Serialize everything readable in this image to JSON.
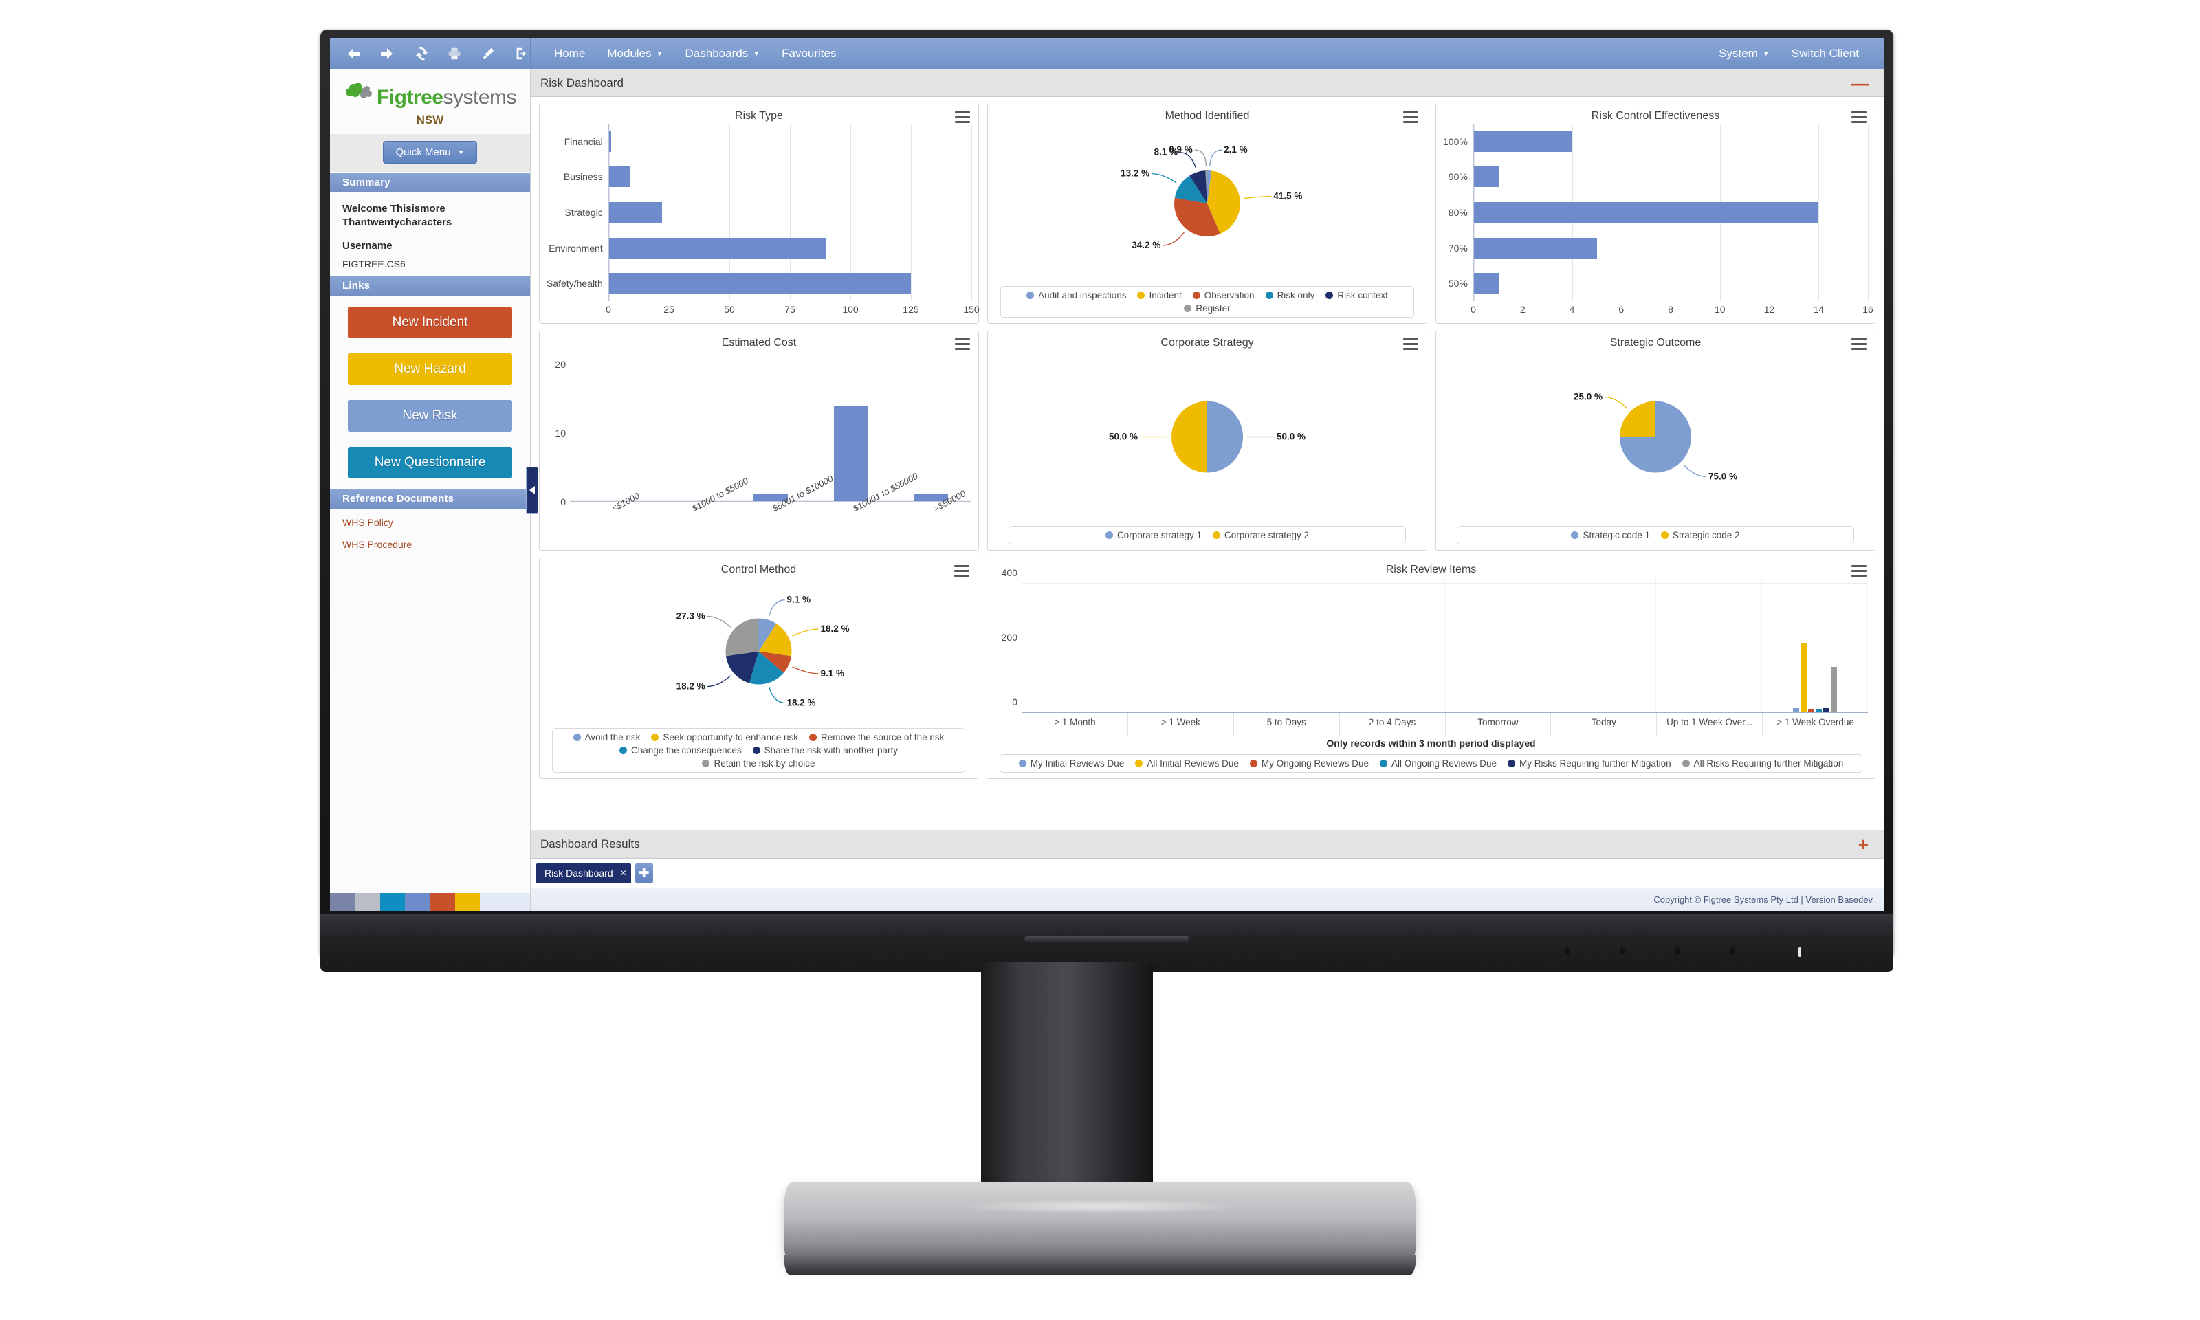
{
  "toolbar": {
    "icons": [
      {
        "name": "back-icon",
        "label": "Back"
      },
      {
        "name": "forward-icon",
        "label": "Forward"
      },
      {
        "name": "refresh-icon",
        "label": "Refresh"
      },
      {
        "name": "print-icon",
        "label": "Print"
      },
      {
        "name": "theme-brush-icon",
        "label": "Theme"
      },
      {
        "name": "logout-icon",
        "label": "Log out"
      }
    ]
  },
  "menu": {
    "items": [
      {
        "label": "Home",
        "caret": false
      },
      {
        "label": "Modules",
        "caret": true
      },
      {
        "label": "Dashboards",
        "caret": true
      },
      {
        "label": "Favourites",
        "caret": false
      }
    ],
    "right": [
      {
        "label": "System",
        "caret": true
      },
      {
        "label": "Switch Client",
        "caret": false
      }
    ],
    "caret_glyph": "▼"
  },
  "sidebar": {
    "logo_primary": "Figtree",
    "logo_secondary": "systems",
    "region": "NSW",
    "quick_menu": "Quick Menu",
    "quick_menu_caret": "▼",
    "summary_header": "Summary",
    "welcome": "Welcome Thisismore Thantwentycharacters",
    "username_label": "Username",
    "username_value": "FIGTREE.CS6",
    "links_header": "Links",
    "links": [
      {
        "label": "New Incident",
        "color": "#c8502b",
        "cls": "link-incident"
      },
      {
        "label": "New Hazard",
        "color": "#efbb00",
        "cls": "link-hazard"
      },
      {
        "label": "New Risk",
        "color": "#7e9dd0",
        "cls": "link-risk"
      },
      {
        "label": "New Questionnaire",
        "color": "#1789b5",
        "cls": "link-quest"
      }
    ],
    "refdocs_header": "Reference Documents",
    "refdocs": [
      {
        "label": "WHS Policy"
      },
      {
        "label": "WHS Procedure"
      }
    ],
    "color_strip": [
      "#7a83a8",
      "#b9bec6",
      "#0f8ec1",
      "#6e8ccb",
      "#c8502b",
      "#efbb00",
      "#e3eaf6"
    ]
  },
  "page": {
    "title": "Risk Dashboard",
    "collapse_glyph": "—",
    "results_title": "Dashboard Results",
    "results_plus_glyph": "+"
  },
  "tabs": {
    "active": "Risk Dashboard",
    "close_glyph": "✕",
    "add_glyph": "✚"
  },
  "footer": {
    "copyright": "Copyright © Figtree Systems Pty Ltd | Version Basedev"
  },
  "colors": {
    "bar_blue": "#6e8ccb",
    "pie_lightblue": "#7e9dd0",
    "pie_yellow": "#efbb00",
    "pie_red": "#c8502b",
    "pie_cyan": "#1789b5",
    "pie_navy": "#1f2f6b",
    "pie_grey": "#9a9a9a",
    "accent_blue": "#7d9ccf",
    "header_grey": "#e3e3e3"
  },
  "chart_data": [
    {
      "id": "risk-type",
      "type": "bar",
      "orientation": "horizontal",
      "title": "Risk Type",
      "categories": [
        "Financial",
        "Business",
        "Strategic",
        "Environment",
        "Safety/health"
      ],
      "values": [
        1,
        9,
        22,
        90,
        125
      ],
      "xticks": [
        0,
        25,
        50,
        75,
        100,
        125,
        150
      ],
      "xlim": [
        0,
        150
      ],
      "ylabel": "",
      "xlabel": "",
      "grid": true,
      "series_color": "#6e8ccb"
    },
    {
      "id": "method-identified",
      "type": "pie",
      "title": "Method Identified",
      "labels": [
        "Audit and inspections",
        "Incident",
        "Observation",
        "Risk only",
        "Risk context",
        "Register"
      ],
      "values": [
        2.1,
        41.5,
        34.2,
        13.2,
        8.1,
        0.9
      ],
      "value_labels": [
        "2.1 %",
        "41.5 %",
        "34.2 %",
        "13.2 %",
        "8.1 %",
        "0.9 %"
      ],
      "colors": [
        "#7e9dd0",
        "#efbb00",
        "#c8502b",
        "#1789b5",
        "#1f2f6b",
        "#9a9a9a"
      ],
      "legend_position": "bottom"
    },
    {
      "id": "risk-control-effectiveness",
      "type": "bar",
      "orientation": "horizontal",
      "title": "Risk Control Effectiveness",
      "categories": [
        "100%",
        "90%",
        "80%",
        "70%",
        "50%"
      ],
      "values": [
        4,
        1,
        14,
        5,
        1
      ],
      "xticks": [
        0,
        2,
        4,
        6,
        8,
        10,
        12,
        14,
        16
      ],
      "xlim": [
        0,
        16
      ],
      "grid": true,
      "series_color": "#6e8ccb"
    },
    {
      "id": "estimated-cost",
      "type": "bar",
      "orientation": "vertical",
      "title": "Estimated Cost",
      "categories": [
        "<$1000",
        "$1000 to $5000",
        "$5001 to $10000",
        "$10001 to $50000",
        ">$50000"
      ],
      "values": [
        0,
        0,
        1,
        14,
        1
      ],
      "yticks": [
        0,
        10,
        20
      ],
      "ylim": [
        0,
        22
      ],
      "grid": true,
      "series_color": "#6e8ccb"
    },
    {
      "id": "corporate-strategy",
      "type": "pie",
      "title": "Corporate Strategy",
      "labels": [
        "Corporate strategy 1",
        "Corporate strategy 2"
      ],
      "values": [
        50.0,
        50.0
      ],
      "value_labels": [
        "50.0 %",
        "50.0 %"
      ],
      "colors": [
        "#7e9dd0",
        "#efbb00"
      ],
      "legend_position": "bottom"
    },
    {
      "id": "strategic-outcome",
      "type": "pie",
      "title": "Strategic Outcome",
      "labels": [
        "Strategic code 1",
        "Strategic code 2"
      ],
      "values": [
        75.0,
        25.0
      ],
      "value_labels": [
        "75.0 %",
        "25.0 %"
      ],
      "colors": [
        "#7e9dd0",
        "#efbb00"
      ],
      "legend_position": "bottom"
    },
    {
      "id": "control-method",
      "type": "pie",
      "title": "Control Method",
      "labels": [
        "Avoid the risk",
        "Seek opportunity to enhance risk",
        "Remove the source of the risk",
        "Change the consequences",
        "Share the risk with another party",
        "Retain the risk by choice"
      ],
      "values": [
        9.1,
        18.2,
        9.1,
        18.2,
        18.2,
        27.3
      ],
      "value_labels": [
        "9.1 %",
        "18.2 %",
        "9.1 %",
        "18.2 %",
        "18.2 %",
        "27.3 %"
      ],
      "colors": [
        "#7e9dd0",
        "#efbb00",
        "#c8502b",
        "#1789b5",
        "#1f2f6b",
        "#9a9a9a"
      ],
      "legend_position": "bottom"
    },
    {
      "id": "risk-review-items",
      "type": "bar",
      "orientation": "vertical",
      "grouped": true,
      "title": "Risk Review Items",
      "categories": [
        "> 1 Month",
        "> 1 Week",
        "5 to Days",
        "2 to 4 Days",
        "Tomorrow",
        "Today",
        "Up to 1 Week Over...",
        "> 1 Week Overdue"
      ],
      "yticks": [
        0,
        200,
        400
      ],
      "ylim": [
        0,
        420
      ],
      "note": "Only records within 3 month period displayed",
      "series": [
        {
          "name": "My Initial Reviews Due",
          "color": "#7e9dd0",
          "values": [
            0,
            0,
            0,
            0,
            0,
            0,
            0,
            12
          ]
        },
        {
          "name": "All Initial Reviews Due",
          "color": "#efbb00",
          "values": [
            0,
            0,
            0,
            0,
            0,
            0,
            0,
            214
          ]
        },
        {
          "name": "My Ongoing Reviews Due",
          "color": "#c8502b",
          "values": [
            0,
            0,
            0,
            0,
            0,
            0,
            0,
            8
          ]
        },
        {
          "name": "All Ongoing Reviews Due",
          "color": "#1789b5",
          "values": [
            0,
            0,
            0,
            0,
            0,
            0,
            0,
            10
          ]
        },
        {
          "name": "My Risks Requiring further Mitigation",
          "color": "#1f2f6b",
          "values": [
            0,
            0,
            0,
            0,
            0,
            0,
            0,
            12
          ]
        },
        {
          "name": "All Risks Requiring further Mitigation",
          "color": "#9a9a9a",
          "values": [
            0,
            0,
            0,
            0,
            0,
            0,
            0,
            142
          ]
        }
      ]
    }
  ]
}
